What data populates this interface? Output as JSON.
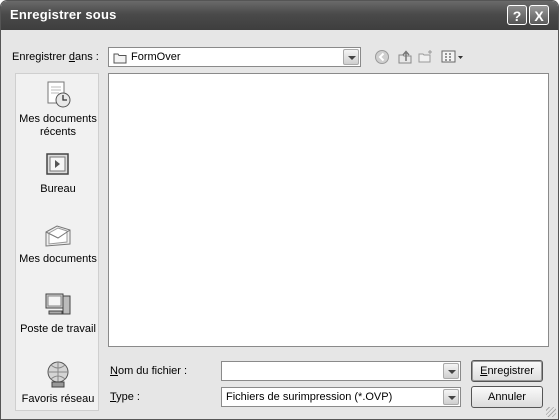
{
  "window": {
    "title": "Enregistrer sous",
    "help_glyph": "?",
    "close_glyph": "X"
  },
  "toolbar": {
    "save_in_label_pre": "Enregistrer ",
    "save_in_label_accel": "d",
    "save_in_label_post": "ans :",
    "save_in_value": "FormOver"
  },
  "places": [
    {
      "label": "Mes documents récents",
      "icon": "recent-documents-icon"
    },
    {
      "label": "Bureau",
      "icon": "desktop-icon"
    },
    {
      "label": "Mes documents",
      "icon": "my-documents-icon"
    },
    {
      "label": "Poste de travail",
      "icon": "my-computer-icon"
    },
    {
      "label": "Favoris réseau",
      "icon": "network-places-icon"
    }
  ],
  "form": {
    "filename_label_accel": "N",
    "filename_label_rest": "om du fichier :",
    "filename_value": "",
    "type_label_accel": "T",
    "type_label_rest": "ype :",
    "type_value": "Fichiers de surimpression (*.OVP)"
  },
  "buttons": {
    "save_accel": "E",
    "save_rest": "nregistrer",
    "cancel": "Annuler"
  }
}
